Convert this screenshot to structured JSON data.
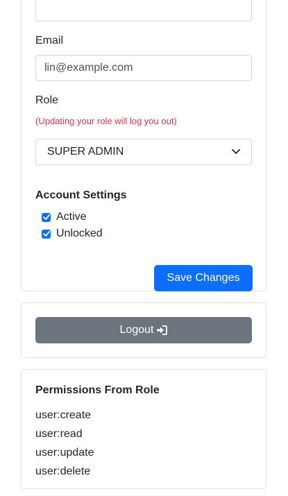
{
  "profile": {
    "email_label": "Email",
    "email_value": "lin@example.com",
    "role_label": "Role",
    "role_warning": "(Updating your role will log you out)",
    "role_selected": "SUPER ADMIN",
    "account_settings_heading": "Account Settings",
    "checkboxes": [
      {
        "label": "Active",
        "checked": true
      },
      {
        "label": "Unlocked",
        "checked": true
      }
    ],
    "save_label": "Save Changes"
  },
  "logout": {
    "label": "Logout",
    "icon": "sign-in-icon"
  },
  "permissions": {
    "heading": "Permissions From Role",
    "items": [
      "user:create",
      "user:read",
      "user:update",
      "user:delete"
    ]
  },
  "colors": {
    "primary": "#0d6efd",
    "secondary": "#6c757d",
    "danger": "#dc3545",
    "border": "#dfe2e6"
  }
}
